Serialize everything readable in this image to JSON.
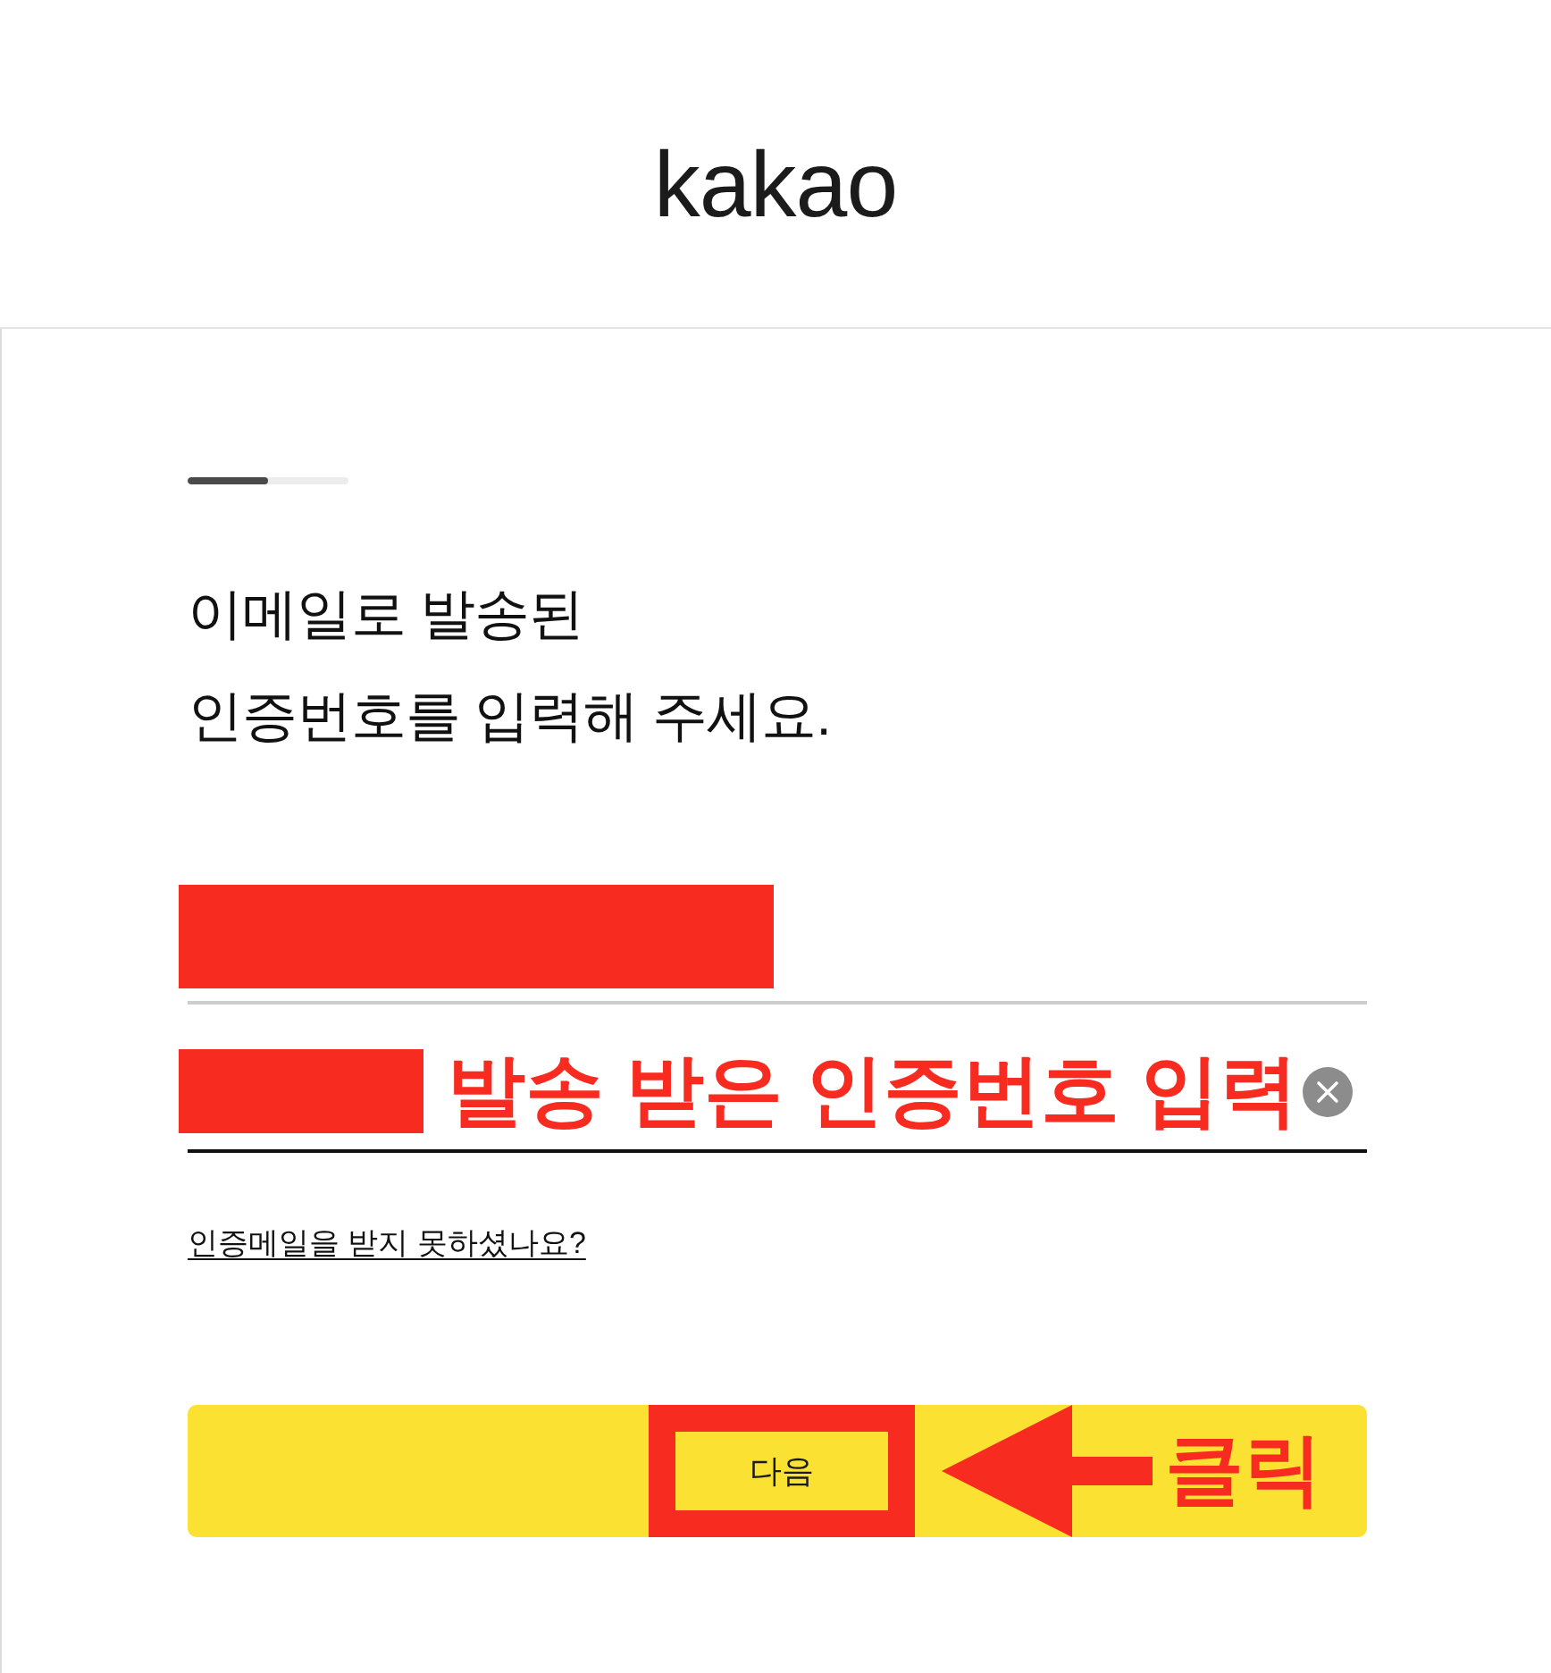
{
  "header": {
    "logo": "kakao"
  },
  "progress": {
    "level": 0.5
  },
  "heading": [
    "이메일로 발송된",
    "인증번호를 입력해 주세요."
  ],
  "fields": [
    {
      "focused": false,
      "redacted": true
    },
    {
      "focused": true,
      "redacted": true,
      "clear_button": true,
      "note": "발송 받은 인증번호 입력"
    }
  ],
  "help_link": "인증메일을 받지 못하셨나요?",
  "next_button": {
    "label": "다음",
    "highlighted": true,
    "note": "클릭"
  }
}
